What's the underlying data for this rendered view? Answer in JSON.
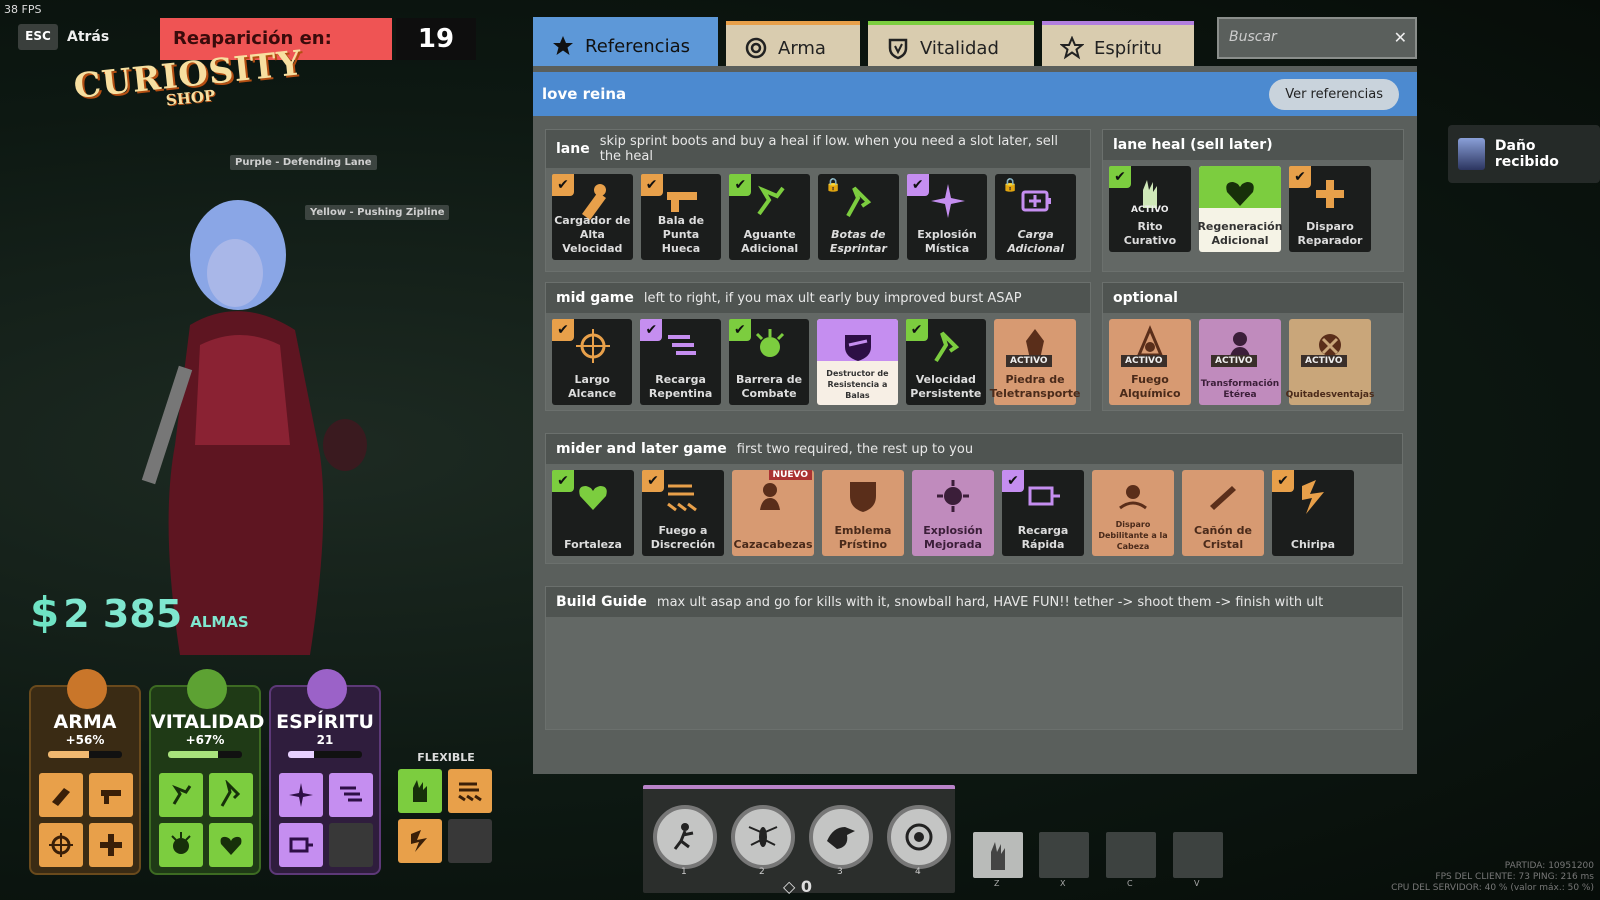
{
  "hud": {
    "fps": "38 FPS",
    "esc_label": "ESC",
    "back_label": "Atrás",
    "respawn_label": "Reaparición en:",
    "respawn_seconds": "19",
    "shop_title": "CURIOSITY",
    "shop_subtitle": "SHOP",
    "lane_tag_purple": "Purple - Defending Lane",
    "lane_tag_yellow": "Yellow - Pushing Zipline",
    "souls_value": "2 385",
    "souls_label": "ALMAS",
    "damage_received": "Daño recibido",
    "flexible_label": "FLEXIBLE",
    "ability_points": "0",
    "net": {
      "match": "PARTIDA: 10951200",
      "client": "FPS DEL CLIENTE: 73   PING: 216 ms",
      "server": "CPU DEL SERVIDOR: 40 % (valor máx.: 50 %)"
    }
  },
  "stats": [
    {
      "name": "ARMA",
      "pct": "+56%",
      "fill": 0.56,
      "color": "#e8a04a"
    },
    {
      "name": "VITALIDAD",
      "pct": "+67%",
      "fill": 0.67,
      "color": "#7ccd3f"
    },
    {
      "name": "ESPÍRITU",
      "pct": "21",
      "fill": 0.35,
      "color": "#b27ede"
    }
  ],
  "tabs": [
    {
      "label": "Referencias",
      "icon": "star-icon",
      "active": true
    },
    {
      "label": "Arma",
      "icon": "weapon-icon",
      "color": "#e8a04a"
    },
    {
      "label": "Vitalidad",
      "icon": "vitality-icon",
      "color": "#7ccd3f"
    },
    {
      "label": "Espíritu",
      "icon": "spirit-icon",
      "color": "#b27ede"
    }
  ],
  "search": {
    "placeholder": "Buscar"
  },
  "build": {
    "name": "love reina",
    "view_refs": "Ver referencias"
  },
  "sections": {
    "lane": {
      "title": "lane",
      "desc": "skip sprint boots and buy a heal if low. when you need a slot later, sell the heal",
      "items": [
        "Cargador de Alta Velocidad",
        "Bala de Punta Hueca",
        "Aguante Adicional",
        "Botas de Esprintar",
        "Explosión Mística",
        "Carga Adicional"
      ]
    },
    "lane_heal": {
      "title": "lane heal (sell later)",
      "items": [
        "Rito Curativo",
        "Regeneración Adicional",
        "Disparo Reparador"
      ],
      "active_badge": "ACTIVO"
    },
    "mid": {
      "title": "mid game",
      "desc": "left to right, if you max ult early buy improved burst ASAP",
      "items": [
        "Largo Alcance",
        "Recarga Repentina",
        "Barrera de Combate",
        "Destructor de Resistencia a Balas",
        "Velocidad Persistente",
        "Piedra de Teletransporte"
      ]
    },
    "optional": {
      "title": "optional",
      "items": [
        "Fuego Alquímico",
        "Transformación Etérea",
        "Quitadesventajas"
      ]
    },
    "mider": {
      "title": "mider and later game",
      "desc": "first two required, the rest up to you",
      "items": [
        "Fortaleza",
        "Fuego a Discreción",
        "Cazacabezas",
        "Emblema Prístino",
        "Explosión Mejorada",
        "Recarga Rápida",
        "Disparo Debilitante a la Cabeza",
        "Cañón de Cristal",
        "Chiripa"
      ],
      "new_badge": "NUEVO"
    },
    "guide": {
      "title": "Build Guide",
      "desc": "max ult asap and go for kills with it, snowball hard, HAVE FUN!! tether -> shoot them -> finish with ult"
    }
  },
  "ability_keys": [
    "1",
    "2",
    "3",
    "4"
  ],
  "slot_keys": [
    "Z",
    "X",
    "C",
    "V"
  ],
  "colors": {
    "weapon": "#e8a04a",
    "vitality": "#7ccd3f",
    "spirit": "#b27ede",
    "accent": "#5d98d8"
  }
}
